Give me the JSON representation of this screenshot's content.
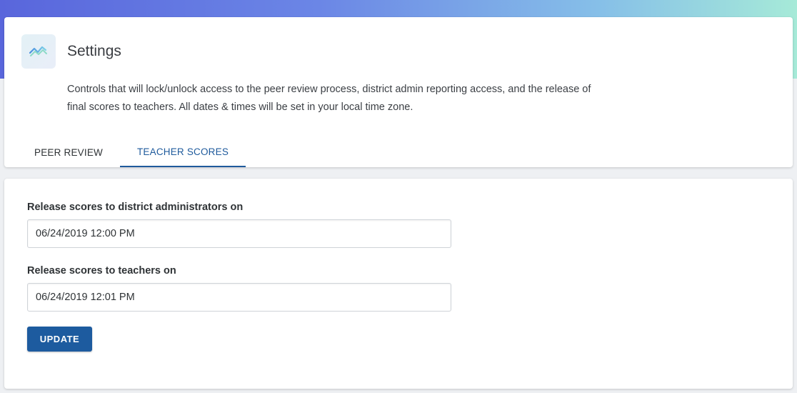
{
  "header": {
    "title": "Settings",
    "logo_icon": "trend-chart-icon",
    "description": "Controls that will lock/unlock access to the peer review process, district admin reporting access, and the release of final scores to teachers. All dates & times will be set in your local time zone."
  },
  "tabs": [
    {
      "label": "PEER REVIEW",
      "active": false
    },
    {
      "label": "TEACHER SCORES",
      "active": true
    }
  ],
  "form": {
    "district_admin": {
      "label": "Release scores to district administrators on",
      "value": "06/24/2019 12:00 PM"
    },
    "teachers": {
      "label": "Release scores to teachers on",
      "value": "06/24/2019 12:01 PM"
    },
    "update_label": "UPDATE"
  },
  "colors": {
    "accent": "#1d5b9f",
    "gradient_start": "#5966dc",
    "gradient_end": "#a6ead8"
  }
}
